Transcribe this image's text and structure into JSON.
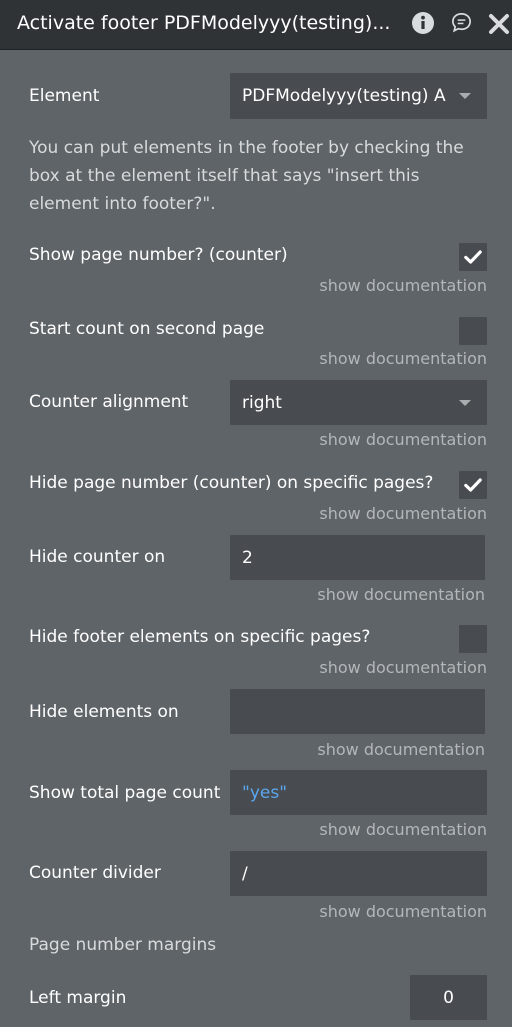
{
  "header": {
    "title": "Activate footer PDFModelyyy(testing)..."
  },
  "properties": {
    "element": {
      "label": "Element",
      "value": "PDFModelyyy(testing) A"
    },
    "description": "You can put elements in the footer by checking the box at the element itself that says \"insert this element into footer?\".",
    "show_page_number": {
      "label": "Show page number? (counter)",
      "checked": true,
      "doc": "show documentation"
    },
    "start_count_second": {
      "label": "Start count on second page",
      "checked": false,
      "doc": "show documentation"
    },
    "counter_alignment": {
      "label": "Counter alignment",
      "value": "right",
      "doc": "show documentation"
    },
    "hide_page_number": {
      "label": "Hide page number (counter) on specific pages?",
      "checked": true,
      "doc": "show documentation"
    },
    "hide_counter_on": {
      "label": "Hide counter on",
      "value": "2",
      "doc": "show documentation"
    },
    "hide_footer_elements": {
      "label": "Hide footer elements on specific pages?",
      "checked": false,
      "doc": "show documentation"
    },
    "hide_elements_on": {
      "label": "Hide elements on",
      "value": "",
      "doc": "show documentation"
    },
    "show_total_page_count": {
      "label": "Show total page count",
      "value": "\"yes\"",
      "doc": "show documentation"
    },
    "counter_divider": {
      "label": "Counter divider",
      "value": "/",
      "doc": "show documentation"
    },
    "page_number_margins": {
      "label": "Page number margins"
    },
    "left_margin": {
      "label": "Left margin",
      "value": "0"
    }
  },
  "icons": [
    "info-icon",
    "comment-icon",
    "close-icon",
    "dropdown-caret-icon",
    "checkmark-icon"
  ],
  "colors": {
    "panel_bg": "#5f6468",
    "header_bg": "#2f3336",
    "field_bg": "#484c50",
    "dynamic_text": "#5aa6ef",
    "doc_text": "#b3b7ba"
  }
}
